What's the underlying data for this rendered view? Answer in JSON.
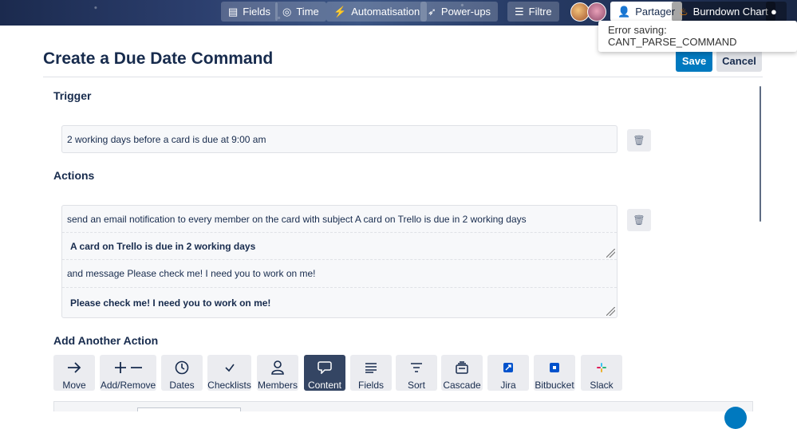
{
  "topbar": {
    "buttons": [
      {
        "label": "Fields",
        "icon": "fields-icon"
      },
      {
        "label": "Time",
        "icon": "clock-icon"
      },
      {
        "label": "Automatisation",
        "icon": "lightning-icon"
      },
      {
        "label": "Power-ups",
        "icon": "rocket-icon"
      },
      {
        "label": "Filtre",
        "icon": "filter-icon"
      },
      {
        "label": "Partager",
        "icon": "add-person-icon"
      },
      {
        "label": "Burndown Chart",
        "icon": "flame-icon"
      }
    ]
  },
  "toast": {
    "message": "Error saving: CANT_PARSE_COMMAND"
  },
  "header": {
    "title": "Create a Due Date Command",
    "save_label": "Save",
    "cancel_label": "Cancel"
  },
  "trigger": {
    "heading": "Trigger",
    "text": "2 working days before a card is due at 9:00 am"
  },
  "actions": {
    "heading": "Actions",
    "email_line": "send an email notification to every member on the card with subject A card on Trello is due in 2 working days",
    "subject_value": "A card on Trello is due in 2 working days",
    "message_line": "and message Please check me! I need you to work on me!",
    "message_value": "Please check me! I need you to work on me!"
  },
  "add_action": {
    "heading": "Add Another Action",
    "types": [
      {
        "label": "Move",
        "icon": "arrow-right-icon"
      },
      {
        "label": "Add/Remove",
        "icon": "plus-minus-icon"
      },
      {
        "label": "Dates",
        "icon": "clock-icon"
      },
      {
        "label": "Checklists",
        "icon": "checkmark-icon"
      },
      {
        "label": "Members",
        "icon": "person-icon"
      },
      {
        "label": "Content",
        "icon": "speech-bubble-icon",
        "active": true
      },
      {
        "label": "Fields",
        "icon": "lines-icon"
      },
      {
        "label": "Sort",
        "icon": "sort-icon"
      },
      {
        "label": "Cascade",
        "icon": "cascade-icon"
      },
      {
        "label": "Jira",
        "icon": "jira-icon"
      },
      {
        "label": "Bitbucket",
        "icon": "bitbucket-icon"
      },
      {
        "label": "Slack",
        "icon": "slack-icon"
      }
    ]
  },
  "colors": {
    "primary": "#0079bf",
    "active_tile": "#344563",
    "text": "#172b4d"
  }
}
